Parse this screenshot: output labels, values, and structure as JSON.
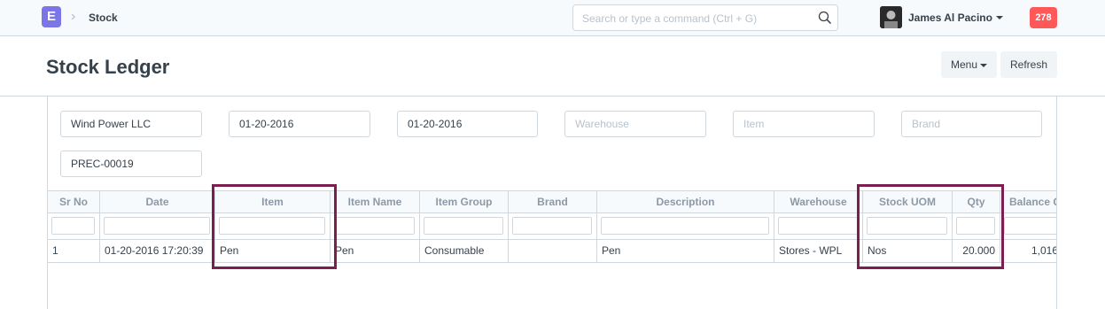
{
  "navbar": {
    "logo_letter": "E",
    "breadcrumb": "Stock",
    "search_placeholder": "Search or type a command (Ctrl + G)",
    "user_name": "James Al Pacino",
    "notification_count": "278"
  },
  "page": {
    "title": "Stock Ledger",
    "menu_label": "Menu",
    "refresh_label": "Refresh"
  },
  "filters": {
    "company": "Wind Power LLC",
    "from_date": "01-20-2016",
    "to_date": "01-20-2016",
    "warehouse_placeholder": "Warehouse",
    "item_placeholder": "Item",
    "brand_placeholder": "Brand",
    "voucher_no": "PREC-00019"
  },
  "grid": {
    "columns": [
      "Sr No",
      "Date",
      "Item",
      "Item Name",
      "Item Group",
      "Brand",
      "Description",
      "Warehouse",
      "Stock UOM",
      "Qty",
      "Balance Qty"
    ],
    "rows": [
      [
        "1",
        "01-20-2016 17:20:39",
        "Pen",
        "Pen",
        "Consumable",
        "",
        "Pen",
        "Stores - WPL",
        "Nos",
        "20.000",
        "1,016"
      ]
    ]
  },
  "colors": {
    "logo": "#7c75e8",
    "notification": "#ff5858",
    "highlight": "#7a1f4f"
  }
}
